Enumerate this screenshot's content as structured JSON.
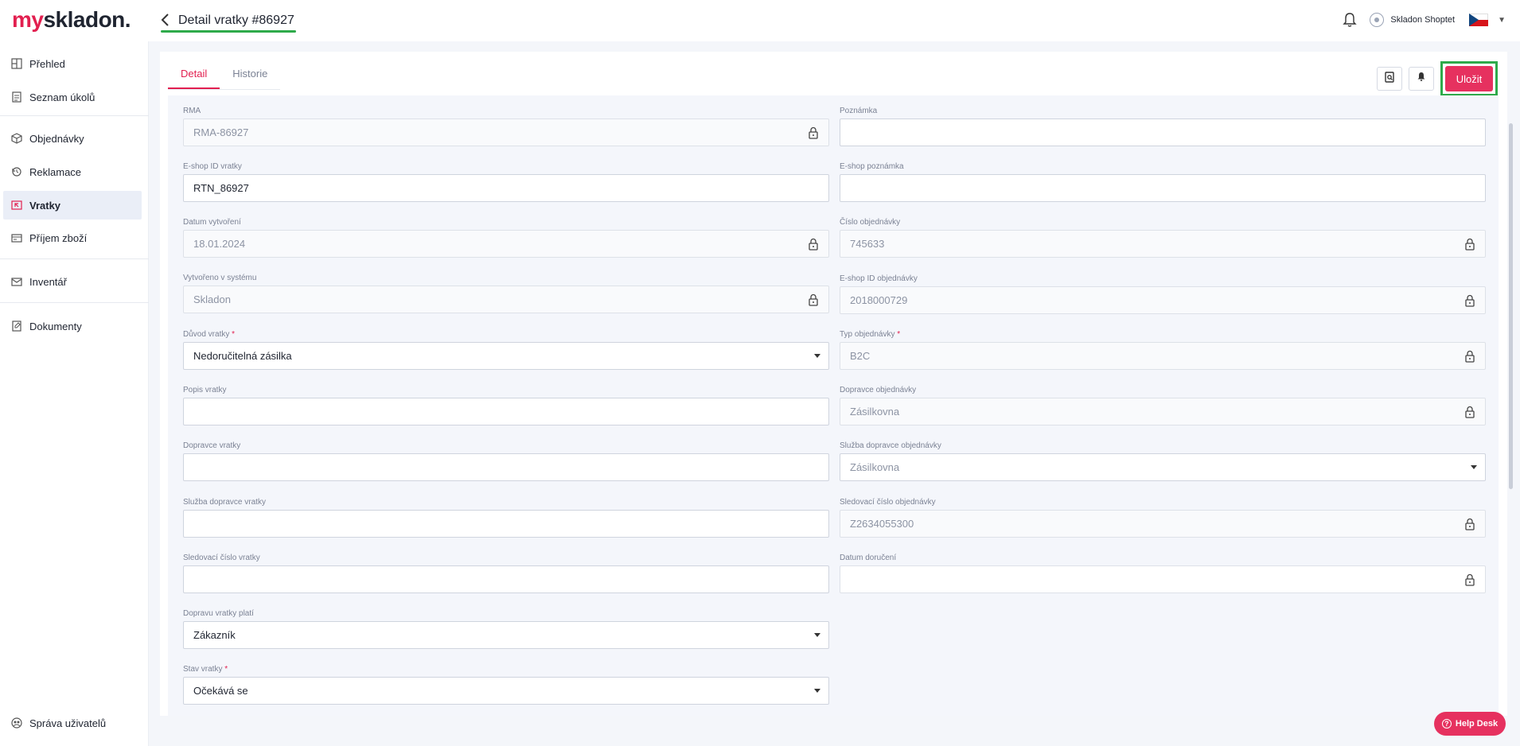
{
  "app": {
    "logo_my": "my",
    "logo_rest": "skladon.",
    "page_title": "Detail vratky #86927",
    "user_name": "Skladon Shoptet"
  },
  "sidebar": {
    "items": [
      {
        "label": "Přehled",
        "icon": "dashboard-icon"
      },
      {
        "label": "Seznam úkolů",
        "icon": "task-list-icon"
      },
      {
        "label": "Objednávky",
        "icon": "box-icon"
      },
      {
        "label": "Reklamace",
        "icon": "refresh-icon"
      },
      {
        "label": "Vratky",
        "icon": "return-icon"
      },
      {
        "label": "Příjem zboží",
        "icon": "receive-icon"
      },
      {
        "label": "Inventář",
        "icon": "inventory-icon"
      },
      {
        "label": "Dokumenty",
        "icon": "document-icon"
      },
      {
        "label": "Správa uživatelů",
        "icon": "users-icon"
      }
    ]
  },
  "tabs": [
    "Detail",
    "Historie"
  ],
  "actions": {
    "save_label": "Uložit"
  },
  "form": {
    "left": [
      {
        "label": "RMA",
        "value": "RMA-86927",
        "locked": true,
        "required": false
      },
      {
        "label": "E-shop ID vratky",
        "value": "RTN_86927",
        "locked": false,
        "required": false
      },
      {
        "label": "Datum vytvoření",
        "value": "18.01.2024",
        "locked": true,
        "required": false
      },
      {
        "label": "Vytvořeno v systému",
        "value": "Skladon",
        "locked": true,
        "required": false
      },
      {
        "label": "Důvod vratky",
        "value": "Nedoručitelná zásilka",
        "locked": false,
        "required": true,
        "dropdown": true
      },
      {
        "label": "Popis vratky",
        "value": "",
        "locked": false,
        "required": false
      },
      {
        "label": "Dopravce vratky",
        "value": "",
        "locked": false,
        "required": false
      },
      {
        "label": "Služba dopravce vratky",
        "value": "",
        "locked": false,
        "required": false
      },
      {
        "label": "Sledovací číslo vratky",
        "value": "",
        "locked": false,
        "required": false
      },
      {
        "label": "Dopravu vratky platí",
        "value": "Zákazník",
        "locked": false,
        "required": false,
        "dropdown": true
      },
      {
        "label": "Stav vratky",
        "value": "Očekává se",
        "locked": false,
        "required": true,
        "dropdown": true
      }
    ],
    "right": [
      {
        "label": "Poznámka",
        "value": "",
        "locked": false,
        "required": false
      },
      {
        "label": "E-shop poznámka",
        "value": "",
        "locked": false,
        "required": false
      },
      {
        "label": "Číslo objednávky",
        "value": "745633",
        "locked": true,
        "required": false
      },
      {
        "label": "E-shop ID objednávky",
        "value": "2018000729",
        "locked": true,
        "required": false
      },
      {
        "label": "Typ objednávky",
        "value": "B2C",
        "locked": true,
        "required": true
      },
      {
        "label": "Dopravce objednávky",
        "value": "Zásilkovna",
        "locked": true,
        "required": false
      },
      {
        "label": "Služba dopravce objednávky",
        "value": "Zásilkovna",
        "locked": false,
        "required": false,
        "dropdown": true,
        "muted": true
      },
      {
        "label": "Sledovací číslo objednávky",
        "value": "Z2634055300",
        "locked": true,
        "required": false
      },
      {
        "label": "Datum doručení",
        "value": "",
        "locked": true,
        "required": false
      }
    ]
  },
  "helpdesk_label": "Help Desk",
  "colors": {
    "brand": "#e21f4f",
    "save": "#e6315f",
    "highlight": "#2eaa4a"
  }
}
